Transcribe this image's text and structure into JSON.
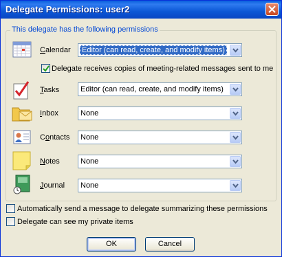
{
  "window": {
    "title": "Delegate Permissions: user2"
  },
  "group": {
    "legend": "This delegate has the following permissions"
  },
  "rows": [
    {
      "label": "Calendar",
      "value": "Editor (can read, create, and modify items)",
      "icon": "calendar-icon"
    },
    {
      "label": "Tasks",
      "value": "Editor (can read, create, and modify items)",
      "icon": "tasks-icon"
    },
    {
      "label": "Inbox",
      "value": "None",
      "icon": "inbox-icon"
    },
    {
      "label": "Contacts",
      "value": "None",
      "icon": "contacts-icon"
    },
    {
      "label": "Notes",
      "value": "None",
      "icon": "notes-icon"
    },
    {
      "label": "Journal",
      "value": "None",
      "icon": "journal-icon"
    }
  ],
  "meeting_copies": {
    "label": "Delegate receives copies of meeting-related messages sent to me",
    "checked": true
  },
  "auto_send": {
    "label": "Automatically send a message to delegate summarizing these permissions",
    "checked": false
  },
  "private_items": {
    "label": "Delegate can see my private items",
    "checked": false
  },
  "buttons": {
    "ok": "OK",
    "cancel": "Cancel"
  },
  "colors": {
    "titlebar": "#0a5fdc",
    "legend_text": "#0046d5",
    "selection": "#316ac5",
    "dialog_bg": "#ece9d8"
  }
}
